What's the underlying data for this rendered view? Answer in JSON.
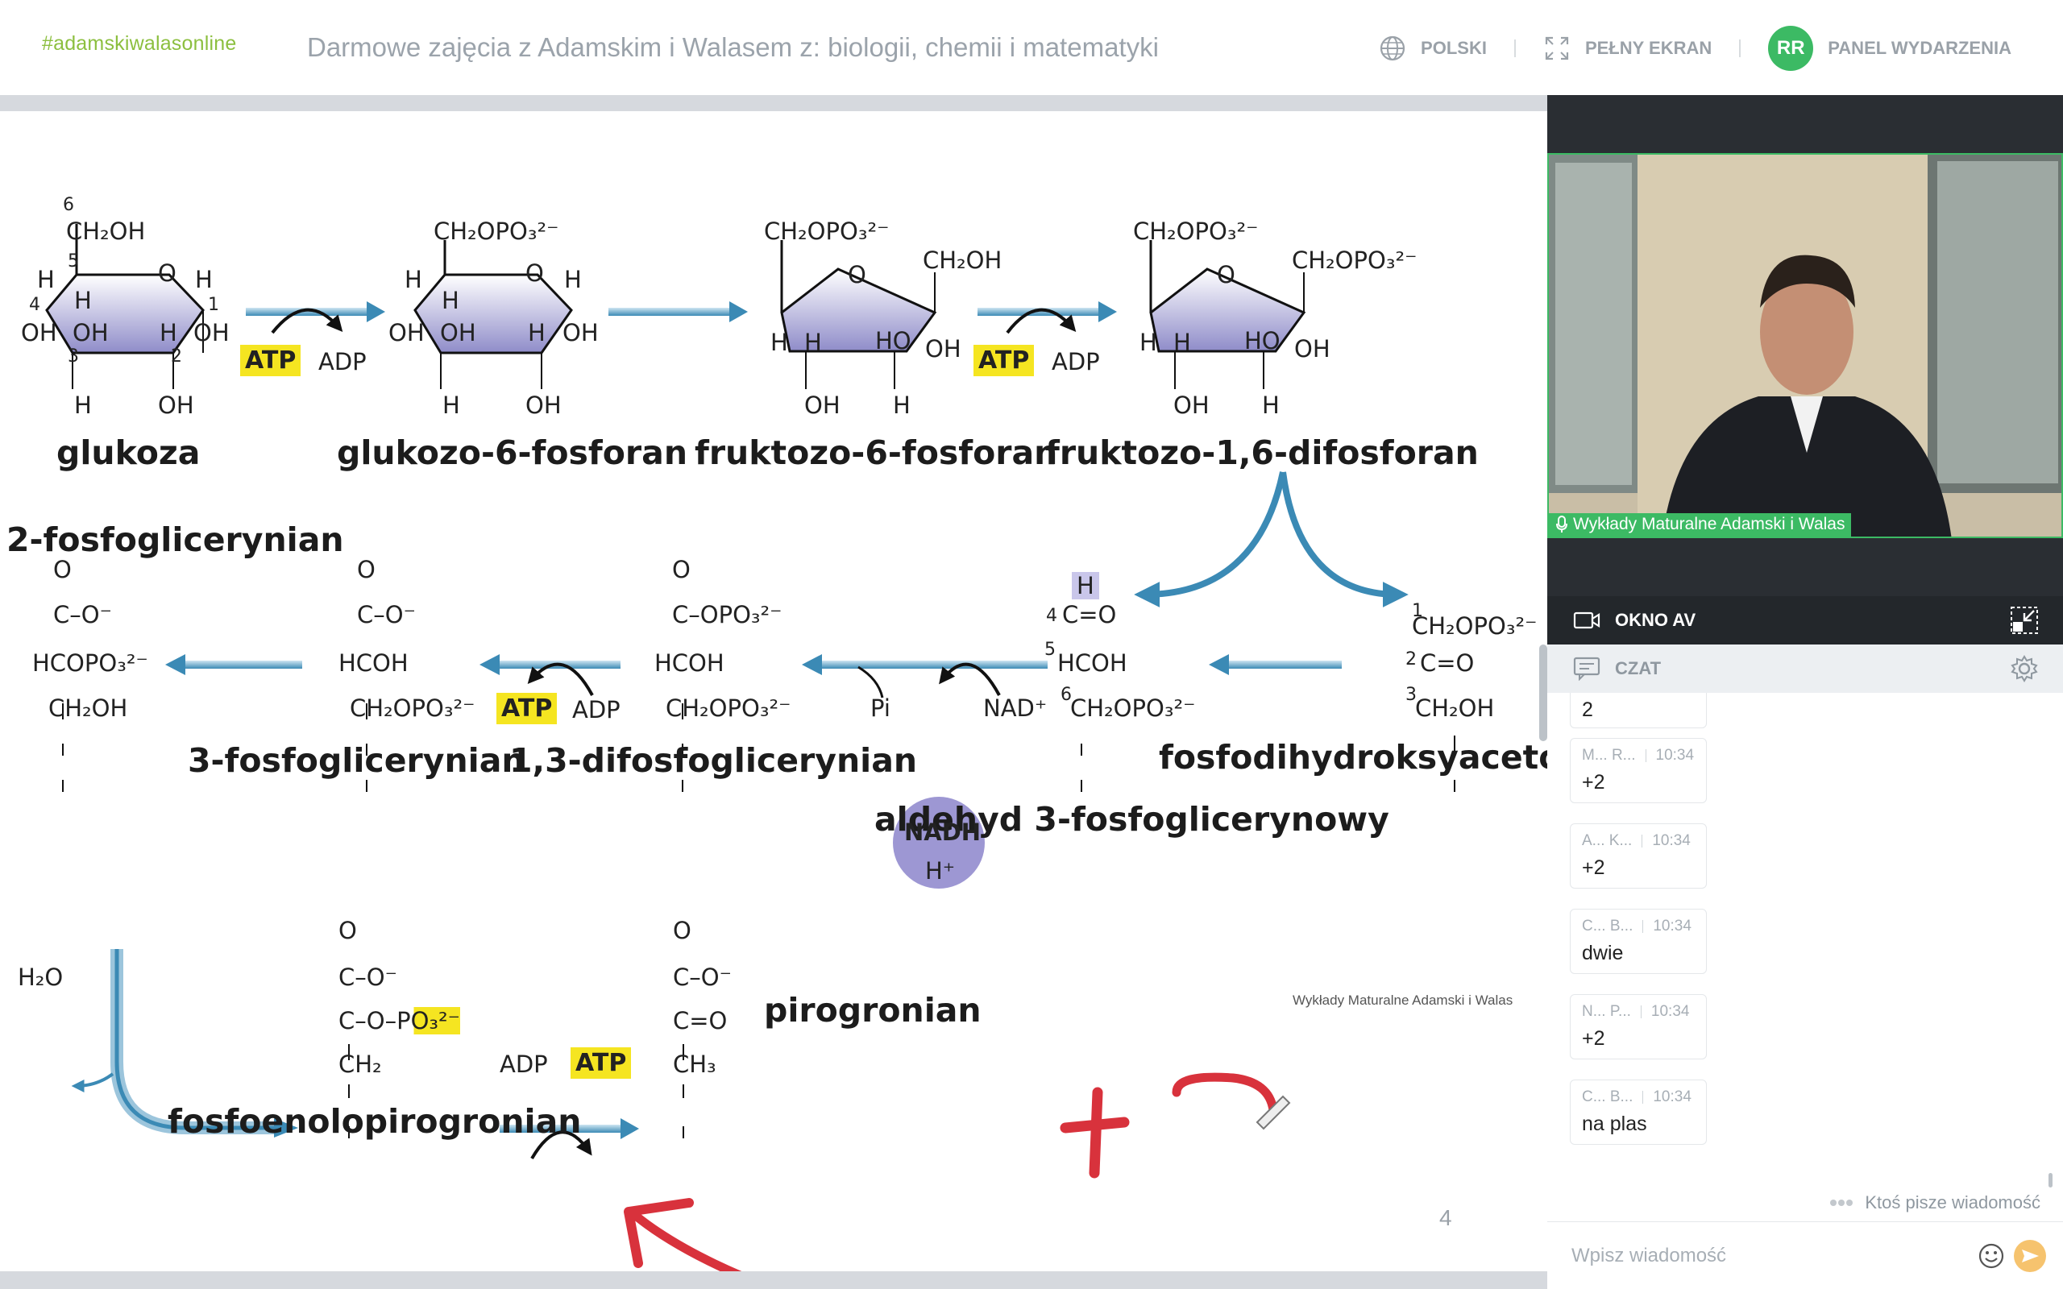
{
  "header": {
    "brand": "#adamskiwalasonline",
    "title": "Darmowe zajęcia z Adamskim i Walasem z: biologii, chemii i matematyki",
    "language_label": "POLSKI",
    "fullscreen_label": "PEŁNY EKRAN",
    "avatar_initials": "RR",
    "panel_label": "PANEL WYDARZENIA"
  },
  "slide": {
    "names": {
      "glukoza": "glukoza",
      "g6p": "glukozo-6-fosforan",
      "f6p": "fruktozo-6-fosforan",
      "f16bp": "fruktozo-1,6-difosforan",
      "pg2": "2-fosfoglicerynian",
      "pg3": "3-fosfoglicerynian",
      "bpg": "1,3-difosfoglicerynian",
      "g3p": "aldehyd 3-fosfoglicerynowy",
      "dhap": "fosfodihydroksyaceton",
      "pep": "fosfoenolopirogronian",
      "pir": "pirogronian"
    },
    "atp": "ATP",
    "adp": "ADP",
    "nad": "NAD⁺",
    "nadh": "NADH",
    "h_plus": "H⁺",
    "pi": "Pi",
    "h2o": "H₂O",
    "watermark": "Wykłady Maturalne Adamski i Walas",
    "page_number": "4",
    "fragments": {
      "ch2oh": "CH₂OH",
      "ch2opo3": "CH₂OPO₃²⁻",
      "hcopo3": "HCOPO₃²⁻",
      "hcoh": "HCOH",
      "c_o_minus": "C–O⁻",
      "c_opo3": "C–OPO₃²⁻",
      "c_o_po3": "C–O–PO₃²⁻",
      "c_double_o": "C=O",
      "ch2": "CH₂",
      "ch3": "CH₃",
      "o": "O",
      "h": "H",
      "oh": "OH",
      "ho": "HO",
      "num6": "6",
      "num5": "5",
      "num4": "4",
      "num3": "3",
      "num2": "2",
      "num1": "1"
    }
  },
  "video": {
    "caption": "Wykłady Maturalne Adamski i Walas"
  },
  "okno_av": {
    "label": "OKNO AV"
  },
  "chat": {
    "label": "CZAT",
    "messages": [
      {
        "author": "",
        "time": "",
        "text": "2"
      },
      {
        "author": "M... R...",
        "time": "10:34",
        "text": "+2"
      },
      {
        "author": "A... K...",
        "time": "10:34",
        "text": "+2"
      },
      {
        "author": "C... B...",
        "time": "10:34",
        "text": "dwie"
      },
      {
        "author": "N... P...",
        "time": "10:34",
        "text": "+2"
      },
      {
        "author": "C... B...",
        "time": "10:34",
        "text": "na plas"
      }
    ],
    "typing": "Ktoś pisze wiadomość",
    "input_placeholder": "Wpisz wiadomość"
  },
  "colors": {
    "accent_green": "#3cba64",
    "brand_green": "#8cbf3f",
    "arrow_blue": "#3b8ab5",
    "atp_yellow": "#f5e521",
    "annotation_red": "#d8323c",
    "ring_purple": "#8f8cc9"
  }
}
